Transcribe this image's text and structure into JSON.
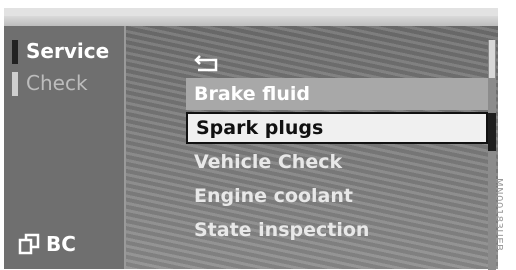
{
  "left_menu": {
    "items": [
      {
        "label": "Service"
      },
      {
        "label": "Check"
      }
    ],
    "bc_label": "BC"
  },
  "main_menu": {
    "back_icon": "back-arrow-icon",
    "items": [
      {
        "label": "Brake fluid"
      },
      {
        "label": "Spark plugs"
      },
      {
        "label": "Vehicle Check"
      },
      {
        "label": "Engine coolant"
      },
      {
        "label": "State inspection"
      }
    ],
    "selected_index": 1
  },
  "image_code": "MN00183UEB",
  "colors": {
    "selected_bg": "#f0f0f0",
    "header_bg": "#a8a8a8",
    "panel_bg": "#6f6f6f"
  }
}
